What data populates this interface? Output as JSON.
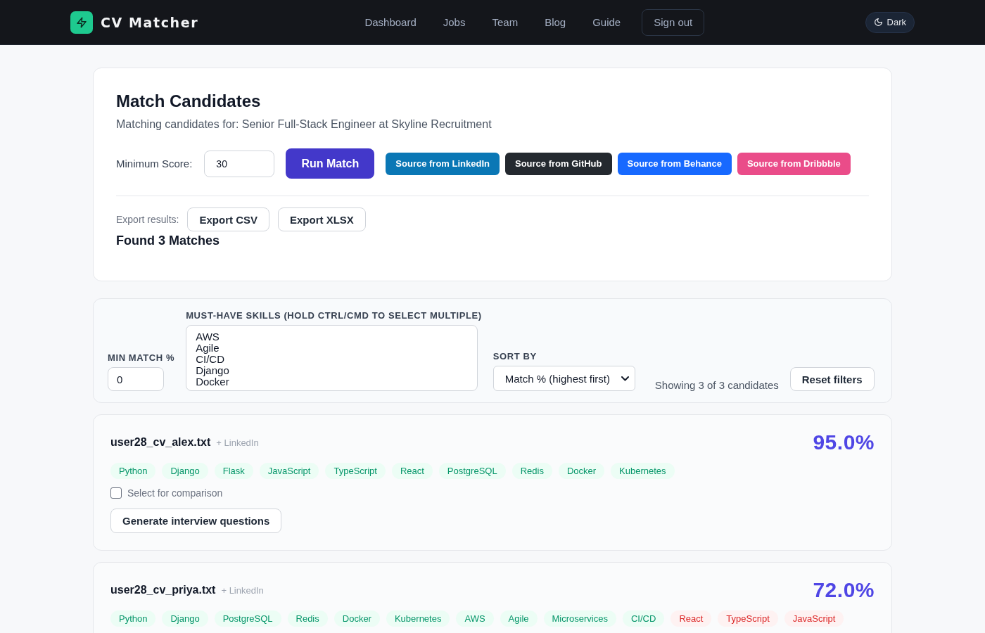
{
  "header": {
    "brand": "CV Matcher",
    "nav": [
      {
        "label": "Dashboard"
      },
      {
        "label": "Jobs"
      },
      {
        "label": "Team"
      },
      {
        "label": "Blog"
      },
      {
        "label": "Guide"
      }
    ],
    "sign_out": "Sign out",
    "theme_toggle": "Dark"
  },
  "match_panel": {
    "title": "Match Candidates",
    "subtitle": "Matching candidates for: Senior Full-Stack Engineer at Skyline Recruitment",
    "min_score": {
      "label": "Minimum Score:",
      "value": "30"
    },
    "run_button": "Run Match",
    "source_buttons": [
      {
        "label": "Source from LinkedIn",
        "color": "#0a77b5"
      },
      {
        "label": "Source from GitHub",
        "color": "#24292f"
      },
      {
        "label": "Source from Behance",
        "color": "#1769ff"
      },
      {
        "label": "Source from Dribbble",
        "color": "#ea4c89"
      }
    ],
    "export": {
      "label": "Export results:",
      "buttons": [
        "Export CSV",
        "Export XLSX"
      ]
    },
    "result_heading": "Found 3 Matches"
  },
  "filters": {
    "min_match": {
      "label": "MIN MATCH %",
      "value": "0"
    },
    "skills": {
      "label": "MUST-HAVE SKILLS (HOLD CTRL/CMD TO SELECT MULTIPLE)",
      "options": [
        {
          "label": "AWS",
          "selected": false
        },
        {
          "label": "Agile",
          "selected": false
        },
        {
          "label": "CI/CD",
          "selected": false
        },
        {
          "label": "Django",
          "selected": false
        },
        {
          "label": "Docker",
          "selected": false
        }
      ]
    },
    "sort": {
      "label": "SORT BY",
      "value": "Match % (highest first)"
    },
    "summary": "Showing 3 of 3 candidates",
    "reset_button": "Reset filters"
  },
  "candidates": [
    {
      "file": "user28_cv_alex.txt",
      "source": "+ LinkedIn",
      "score": "95.0%",
      "skills": [
        {
          "name": "Python",
          "matched": true
        },
        {
          "name": "Django",
          "matched": true
        },
        {
          "name": "Flask",
          "matched": true
        },
        {
          "name": "JavaScript",
          "matched": true
        },
        {
          "name": "TypeScript",
          "matched": true
        },
        {
          "name": "React",
          "matched": true
        },
        {
          "name": "PostgreSQL",
          "matched": true
        },
        {
          "name": "Redis",
          "matched": true
        },
        {
          "name": "Docker",
          "matched": true
        },
        {
          "name": "Kubernetes",
          "matched": true
        }
      ],
      "compare": {
        "label": "Select for comparison",
        "checked": false
      },
      "action": "Generate interview questions"
    },
    {
      "file": "user28_cv_priya.txt",
      "source": "+ LinkedIn",
      "score": "72.0%",
      "skills": [
        {
          "name": "Python",
          "matched": true
        },
        {
          "name": "Django",
          "matched": true
        },
        {
          "name": "PostgreSQL",
          "matched": true
        },
        {
          "name": "Redis",
          "matched": true
        },
        {
          "name": "Docker",
          "matched": true
        },
        {
          "name": "Kubernetes",
          "matched": true
        },
        {
          "name": "AWS",
          "matched": true
        },
        {
          "name": "Agile",
          "matched": true
        },
        {
          "name": "Microservices",
          "matched": true
        },
        {
          "name": "CI/CD",
          "matched": true
        },
        {
          "name": "React",
          "matched": false
        },
        {
          "name": "TypeScript",
          "matched": false
        },
        {
          "name": "JavaScript",
          "matched": false
        }
      ]
    }
  ]
}
